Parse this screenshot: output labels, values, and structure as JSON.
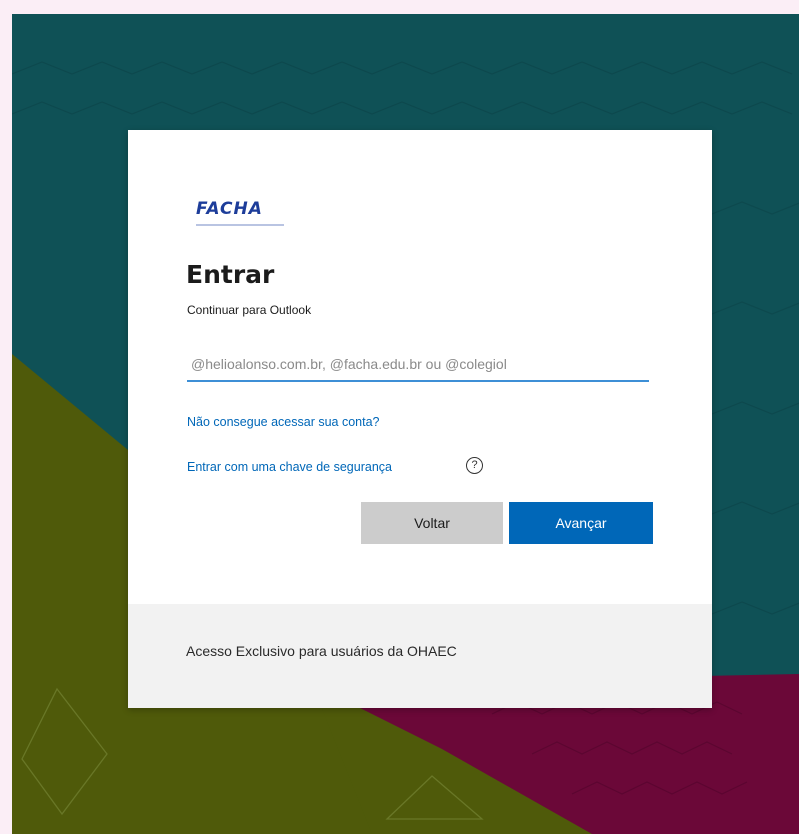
{
  "colors": {
    "background_teal": "#0f5156",
    "background_olive": "#4f5a0a",
    "background_maroon": "#6b0838",
    "primary_blue": "#0067b8",
    "link_blue": "#0067b8",
    "secondary_gray": "#cccccc"
  },
  "signin": {
    "logo_text": "FACHA",
    "title": "Entrar",
    "subtitle": "Continuar para Outlook",
    "email_placeholder": "@helioalonso.com.br, @facha.edu.br ou @colegiol",
    "email_value": "",
    "cant_access_link": "Não consegue acessar sua conta?",
    "security_key_link": "Entrar com uma chave de segurança",
    "help_icon": "question-circle-icon",
    "back_button": "Voltar",
    "next_button": "Avançar"
  },
  "footer": {
    "text": "Acesso Exclusivo para usuários da OHAEC"
  }
}
